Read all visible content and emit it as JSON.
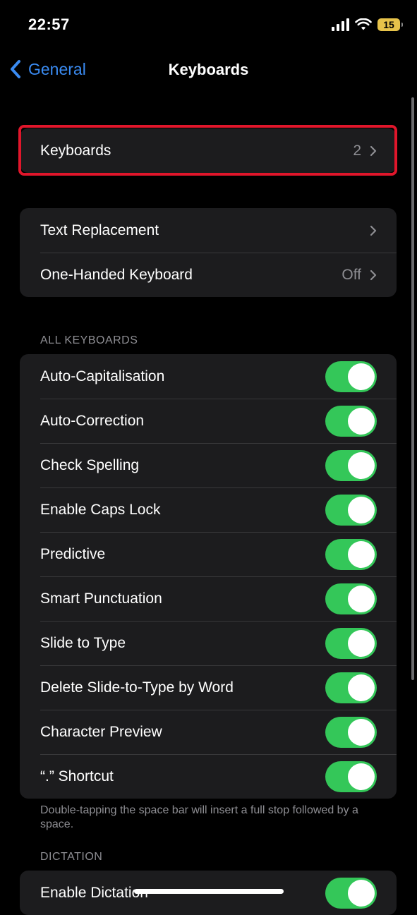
{
  "status_bar": {
    "time": "22:57",
    "battery": "15",
    "battery_color": "#e7c34a"
  },
  "nav": {
    "back_label": "General",
    "title": "Keyboards",
    "accent": "#3a8bf2"
  },
  "highlight_color": "#e0162b",
  "keyboards_row": {
    "label": "Keyboards",
    "value": "2"
  },
  "group2": [
    {
      "label": "Text Replacement",
      "value": ""
    },
    {
      "label": "One-Handed Keyboard",
      "value": "Off"
    }
  ],
  "all_keyboards": {
    "header": "ALL KEYBOARDS",
    "toggles": [
      {
        "label": "Auto-Capitalisation",
        "on": true
      },
      {
        "label": "Auto-Correction",
        "on": true
      },
      {
        "label": "Check Spelling",
        "on": true
      },
      {
        "label": "Enable Caps Lock",
        "on": true
      },
      {
        "label": "Predictive",
        "on": true
      },
      {
        "label": "Smart Punctuation",
        "on": true
      },
      {
        "label": "Slide to Type",
        "on": true
      },
      {
        "label": "Delete Slide-to-Type by Word",
        "on": true
      },
      {
        "label": "Character Preview",
        "on": true
      },
      {
        "label": "“.” Shortcut",
        "on": true
      }
    ],
    "footer": "Double-tapping the space bar will insert a full stop followed by a space."
  },
  "dictation": {
    "header": "DICTATION",
    "toggles": [
      {
        "label": "Enable Dictation",
        "on": true
      }
    ]
  },
  "toggle_on_color": "#34c759"
}
